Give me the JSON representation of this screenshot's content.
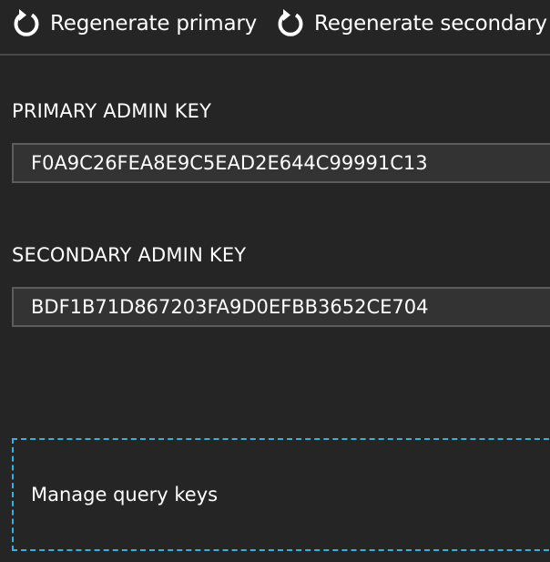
{
  "toolbar": {
    "regenerate_primary_label": "Regenerate primary",
    "regenerate_secondary_label": "Regenerate secondary",
    "icon": "refresh-icon"
  },
  "primary": {
    "label": "PRIMARY ADMIN KEY",
    "value": "F0A9C26FEA8E9C5EAD2E644C99991C13"
  },
  "secondary": {
    "label": "SECONDARY ADMIN KEY",
    "value": "BDF1B71D867203FA9D0EFBB3652CE704"
  },
  "manage": {
    "label": "Manage query keys"
  },
  "colors": {
    "background": "#252526",
    "field_background": "#333333",
    "focus_outline": "#3ab0d8"
  }
}
